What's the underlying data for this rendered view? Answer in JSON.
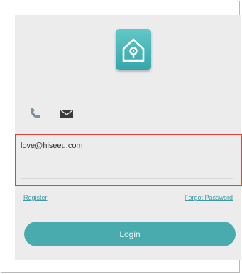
{
  "logo": {
    "icon": "home-icon",
    "color": "#3fb3b6"
  },
  "login_tabs": [
    {
      "icon": "phone-icon",
      "color": "#7e8f95"
    },
    {
      "icon": "mail-icon",
      "color": "#3a3a3a"
    }
  ],
  "form": {
    "email_value": "love@hiseeu.com",
    "password_value": ""
  },
  "links": {
    "register": "Register",
    "forgot_password": "Forgot Password"
  },
  "login_button": {
    "label": "Login",
    "color": "#4aabaf"
  },
  "highlight": {
    "color": "#e0403a"
  }
}
